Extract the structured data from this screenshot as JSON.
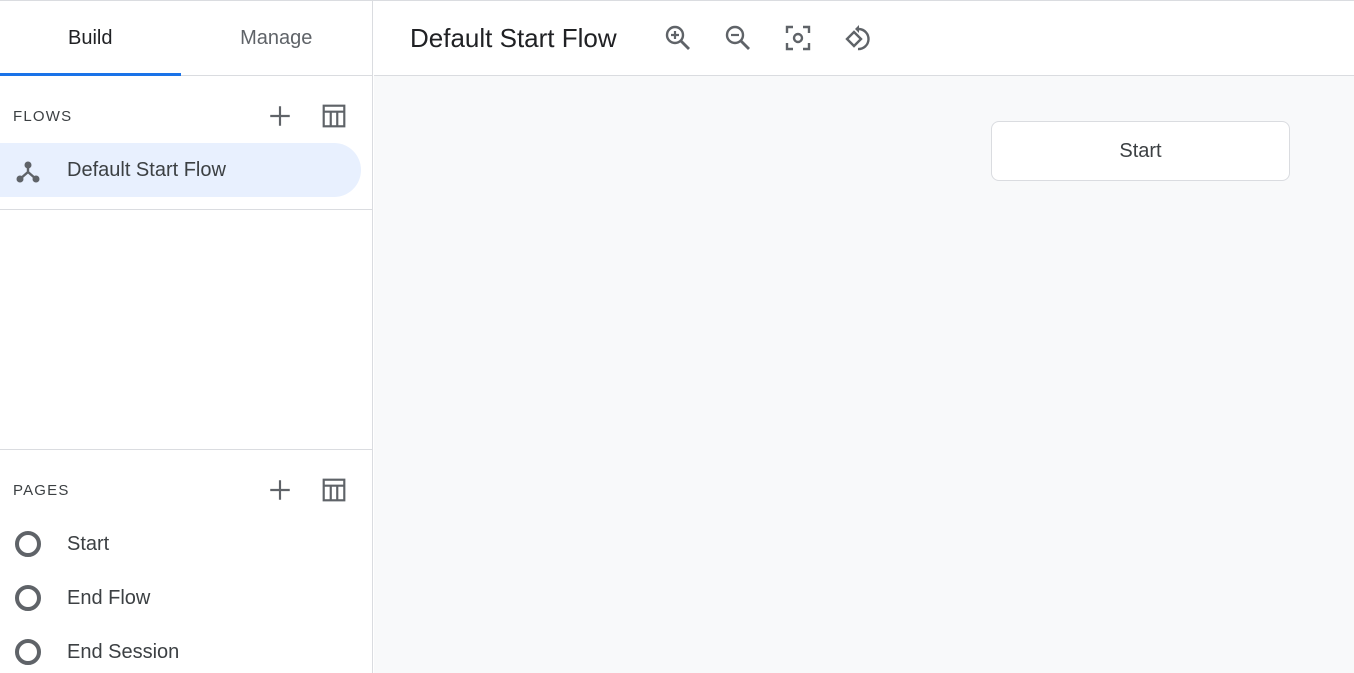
{
  "tabs": [
    {
      "label": "Build",
      "active": true
    },
    {
      "label": "Manage",
      "active": false
    }
  ],
  "flows": {
    "title": "FLOWS",
    "add_icon": "add-icon",
    "table_icon": "table-view-icon",
    "items": [
      {
        "label": "Default Start Flow",
        "icon": "flow-icon",
        "selected": true
      }
    ]
  },
  "pages": {
    "title": "PAGES",
    "add_icon": "add-icon",
    "table_icon": "table-view-icon",
    "items": [
      {
        "label": "Start",
        "icon": "page-circle-icon"
      },
      {
        "label": "End Flow",
        "icon": "page-circle-icon"
      },
      {
        "label": "End Session",
        "icon": "page-circle-icon"
      }
    ]
  },
  "toolbar": {
    "title": "Default Start Flow",
    "tools": [
      "zoom-in-icon",
      "zoom-out-icon",
      "center-focus-icon",
      "rotate-icon"
    ]
  },
  "canvas": {
    "nodes": [
      {
        "label": "Start"
      }
    ]
  },
  "colors": {
    "accent": "#1a73e8",
    "selected_bg": "#e8f0fe",
    "canvas_bg": "#f8f9fa",
    "border": "#dadce0",
    "icon": "#5f6368"
  }
}
